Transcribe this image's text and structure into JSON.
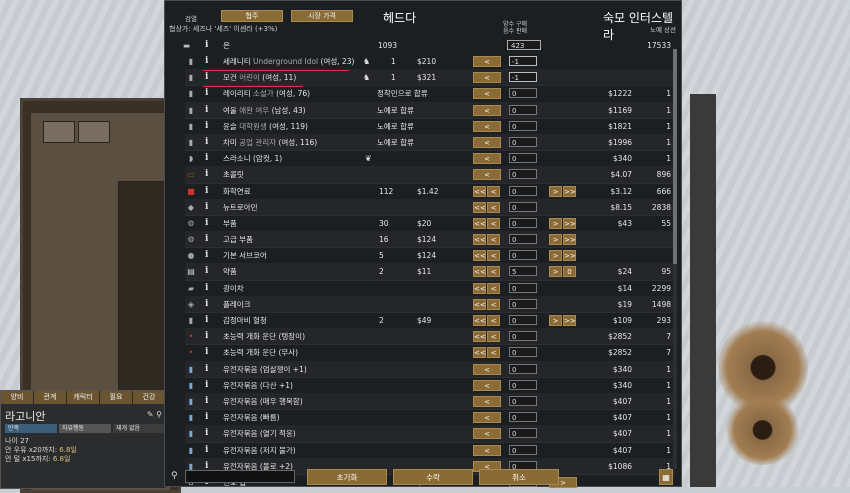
{
  "header": {
    "filter_label": "검열",
    "tab_rescue": "협주",
    "tab_market": "시장 가격",
    "colony_title": "헤드다",
    "negotiator": "협상가: 세즈나 '세즈' 이센라 (+3%)",
    "price_note": [
      "양수 구매",
      "음수 판매"
    ],
    "trader_title": "숙모 인터스텔라",
    "trader_sub": "노예 상선"
  },
  "silver": {
    "name": "은",
    "colony_count": "1093",
    "trade_value": "423",
    "trader_count": "17533"
  },
  "rows": [
    {
      "icon": "person-icon",
      "name": "세레니티",
      "sub": " Underground Idol",
      "tail": " (여성, 23)",
      "pawn_icon": true,
      "ccount": "1",
      "cprice": "$210",
      "left": "wide",
      "qty": "-1",
      "qty_arrow": true,
      "tprice": "",
      "tcount": ""
    },
    {
      "icon": "person-icon",
      "name": "모건",
      "sub": " 어린이",
      "tail": " (여성, 11)",
      "pawn_icon": true,
      "ccount": "1",
      "cprice": "$321",
      "left": "wide",
      "qty": "-1",
      "qty_arrow": true,
      "tprice": "",
      "tcount": ""
    },
    {
      "icon": "person-icon",
      "name": "레이리티",
      "sub": " 소설가",
      "tail": " (여성, 76)",
      "state": "정착민으로 합류",
      "left": "wide",
      "qty": "0",
      "tprice": "$1222",
      "tcount": "1"
    },
    {
      "icon": "person-icon",
      "name": "여울",
      "sub": " 애완 여우",
      "tail": " (남성, 43)",
      "state": "노예로 합류",
      "left": "wide",
      "qty": "0",
      "tprice": "$1169",
      "tcount": "1"
    },
    {
      "icon": "person-icon",
      "name": "윤슬",
      "sub": " 대학원생",
      "tail": " (여성, 119)",
      "state": "노예로 합류",
      "left": "wide",
      "qty": "0",
      "tprice": "$1821",
      "tcount": "1"
    },
    {
      "icon": "person-icon",
      "name": "차미",
      "sub": " 공업 관리자",
      "tail": " (여성, 116)",
      "state": "노예로 합류",
      "left": "wide",
      "qty": "0",
      "tprice": "$1996",
      "tcount": "1"
    },
    {
      "icon": "animal-icon",
      "name": "스라소니",
      "sub": "",
      "tail": " (암컷, 1)",
      "paw": true,
      "left": "wide",
      "qty": "0",
      "tprice": "$340",
      "tcount": "1"
    },
    {
      "icon": "chocolate-icon",
      "name": "초콜릿",
      "sub": "",
      "tail": "",
      "left": "wide",
      "qty": "0",
      "tprice": "$4.07",
      "tcount": "896"
    },
    {
      "icon": "chemfuel-icon",
      "name": "화학연료",
      "sub": "",
      "tail": "",
      "ccount": "112",
      "cprice": "$1.42",
      "left": "double",
      "qty": "0",
      "right": "double",
      "tprice": "$3.12",
      "tcount": "666"
    },
    {
      "icon": "neutroamine-icon",
      "name": "뉴트로아민",
      "sub": "",
      "tail": "",
      "left": "double",
      "qty": "0",
      "tprice": "$8.15",
      "tcount": "2838"
    },
    {
      "icon": "component-icon",
      "name": "부품",
      "sub": "",
      "tail": "",
      "ccount": "30",
      "cprice": "$20",
      "left": "double",
      "qty": "0",
      "right": "double",
      "tprice": "$43",
      "tcount": "55"
    },
    {
      "icon": "adv-component-icon",
      "name": "고급 부품",
      "sub": "",
      "tail": "",
      "ccount": "16",
      "cprice": "$124",
      "left": "double",
      "qty": "0",
      "right": "double",
      "tprice": "",
      "tcount": ""
    },
    {
      "icon": "servocore-icon",
      "name": "기본 서브코어",
      "sub": "",
      "tail": "",
      "ccount": "5",
      "cprice": "$124",
      "left": "double",
      "qty": "0",
      "right": "double",
      "tprice": "",
      "tcount": ""
    },
    {
      "icon": "medicine-icon",
      "name": "약품",
      "sub": "",
      "tail": "",
      "ccount": "2",
      "cprice": "$11",
      "left": "double",
      "qty": "5",
      "right": "single",
      "right_zero": "0",
      "tprice": "$24",
      "tcount": "95"
    },
    {
      "icon": "plasteel-icon",
      "name": "광이차",
      "sub": "",
      "tail": "",
      "left": "double",
      "qty": "0",
      "tprice": "$14",
      "tcount": "2299"
    },
    {
      "icon": "flake-icon",
      "name": "플레이크",
      "sub": "",
      "tail": "",
      "left": "double",
      "qty": "0",
      "tprice": "$19",
      "tcount": "1498"
    },
    {
      "icon": "serum-icon",
      "name": "감정마비 혈청",
      "sub": "",
      "tail": "",
      "ccount": "2",
      "cprice": "$49",
      "left": "double",
      "qty": "0",
      "right": "double",
      "tprice": "$109",
      "tcount": "293"
    },
    {
      "icon": "capsule-icon",
      "name": "초능력 개화 운단 (탱장이)",
      "sub": "",
      "tail": "",
      "left": "double",
      "qty": "0",
      "tprice": "$2852",
      "tcount": "7"
    },
    {
      "icon": "capsule-icon",
      "name": "초능력 개화 운단 (무사)",
      "sub": "",
      "tail": "",
      "left": "double",
      "qty": "0",
      "tprice": "$2852",
      "tcount": "7"
    },
    {
      "icon": "xenogerm-icon",
      "name": "유전자묶음 (엄살쟁이 +1)",
      "sub": "",
      "tail": "",
      "left": "wide",
      "qty": "0",
      "tprice": "$340",
      "tcount": "1"
    },
    {
      "icon": "xenogerm-icon",
      "name": "유전자묶음 (다산 +1)",
      "sub": "",
      "tail": "",
      "left": "wide",
      "qty": "0",
      "tprice": "$340",
      "tcount": "1"
    },
    {
      "icon": "xenogerm-icon",
      "name": "유전자묶음 (매우 행복함)",
      "sub": "",
      "tail": "",
      "left": "wide",
      "qty": "0",
      "tprice": "$407",
      "tcount": "1"
    },
    {
      "icon": "xenogerm-icon",
      "name": "유전자묶음 (빠름)",
      "sub": "",
      "tail": "",
      "left": "wide",
      "qty": "0",
      "tprice": "$407",
      "tcount": "1"
    },
    {
      "icon": "xenogerm-icon",
      "name": "유전자묶음 (열기 적응)",
      "sub": "",
      "tail": "",
      "left": "wide",
      "qty": "0",
      "tprice": "$407",
      "tcount": "1"
    },
    {
      "icon": "xenogerm-icon",
      "name": "유전자묶음 (저지 불가)",
      "sub": "",
      "tail": "",
      "left": "wide",
      "qty": "0",
      "tprice": "$407",
      "tcount": "1"
    },
    {
      "icon": "xenogerm-icon",
      "name": "유전자묶음 (볼로 +2)",
      "sub": "",
      "tail": "",
      "left": "wide",
      "qty": "0",
      "tprice": "$1086",
      "tcount": "1"
    },
    {
      "icon": "tent-icon",
      "name": "신호 집",
      "sub": "",
      "tail": "",
      "ccount": "1",
      "cprice": "$309",
      "qty": "0",
      "right": "single_wide",
      "tprice": "",
      "tcount": ""
    }
  ],
  "footer": {
    "reset": "초기화",
    "accept": "수락",
    "cancel": "취소"
  },
  "pawn_panel": {
    "tabs": [
      "양비",
      "관계",
      "캐릭터",
      "필요",
      "건강"
    ],
    "name": "라고니안",
    "bar_mood": "만족",
    "bar_rest": "자유행동",
    "bar_work": "재개 없음",
    "age": "나이 27",
    "line1_pre": "안 우유 x20까지: ",
    "line1_val": "6.8일",
    "line2_pre": "안 털 x15까지: ",
    "line2_val": "6.8일"
  },
  "colors": {
    "button": "#8a6b35",
    "window": "#1c1f22",
    "underline": "#dd3333"
  }
}
